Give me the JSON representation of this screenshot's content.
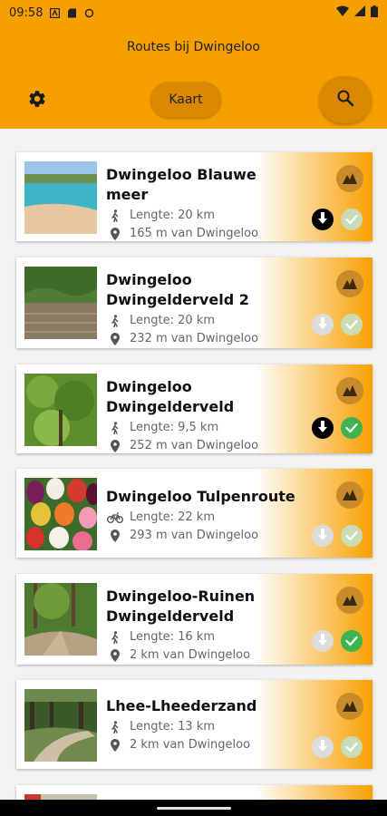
{
  "status_bar": {
    "time": "09:58"
  },
  "header": {
    "title": "Routes bij Dwingeloo",
    "map_button": "Kaart"
  },
  "routes": [
    {
      "name": "Dwingeloo Blauwe meer",
      "mode": "walk",
      "length": "Lengte: 20 km",
      "distance": "165 m van Dwingeloo",
      "downloaded": true,
      "completed": false
    },
    {
      "name": "Dwingeloo Dwingelderveld 2",
      "mode": "walk",
      "length": "Lengte: 20 km",
      "distance": "232 m van Dwingeloo",
      "downloaded": false,
      "completed": false
    },
    {
      "name": "Dwingeloo Dwingelderveld",
      "mode": "walk",
      "length": "Lengte: 9,5 km",
      "distance": "252 m van Dwingeloo",
      "downloaded": true,
      "completed": true
    },
    {
      "name": "Dwingeloo Tulpenroute",
      "mode": "bike",
      "length": "Lengte: 22 km",
      "distance": "293 m van Dwingeloo",
      "downloaded": false,
      "completed": false
    },
    {
      "name": "Dwingeloo-Ruinen Dwingelderveld",
      "mode": "walk",
      "length": "Lengte: 16 km",
      "distance": "2 km van Dwingeloo",
      "downloaded": false,
      "completed": true
    },
    {
      "name": "Lhee-Lheederzand",
      "mode": "walk",
      "length": "Lengte: 13 km",
      "distance": "2 km van Dwingeloo",
      "downloaded": false,
      "completed": false
    }
  ],
  "colors": {
    "accent": "#f59f00",
    "accent_dark": "#d98800",
    "check_on": "#3fb34f"
  }
}
